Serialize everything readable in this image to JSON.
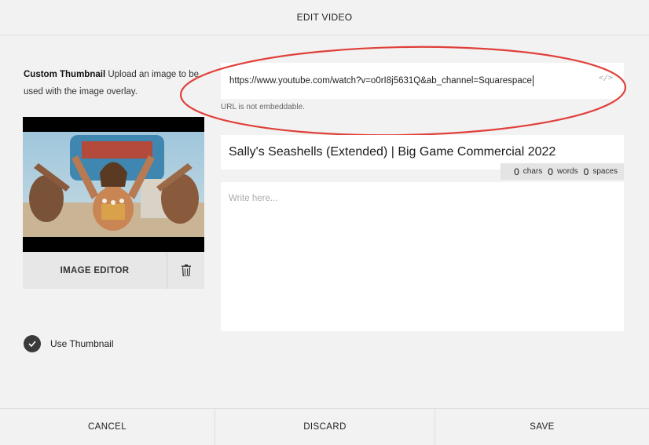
{
  "header": {
    "title": "EDIT VIDEO"
  },
  "thumbnail": {
    "label_strong": "Custom Thumbnail",
    "label_rest": " Upload an image to be used with the image overlay.",
    "image_editor_label": "IMAGE EDITOR",
    "trash_icon": "trash-icon",
    "use_thumbnail_label": "Use Thumbnail",
    "use_thumbnail_checked": true
  },
  "video": {
    "url_value": "https://www.youtube.com/watch?v=o0rI8j5631Q&ab_channel=Squarespace",
    "embed_icon": "</>",
    "url_error": "URL is not embeddable.",
    "title_value": "Sally's Seashells (Extended) | Big Game Commercial 2022",
    "counter": {
      "chars": "0",
      "chars_label": "chars",
      "words": "0",
      "words_label": "words",
      "spaces": "0",
      "spaces_label": "spaces"
    },
    "description_placeholder": "Write here..."
  },
  "footer": {
    "cancel_label": "CANCEL",
    "discard_label": "DISCARD",
    "save_label": "SAVE"
  },
  "colors": {
    "background": "#f2f2f2",
    "annotation_circle": "#e0403a",
    "checkbox": "#3a3a3a"
  }
}
